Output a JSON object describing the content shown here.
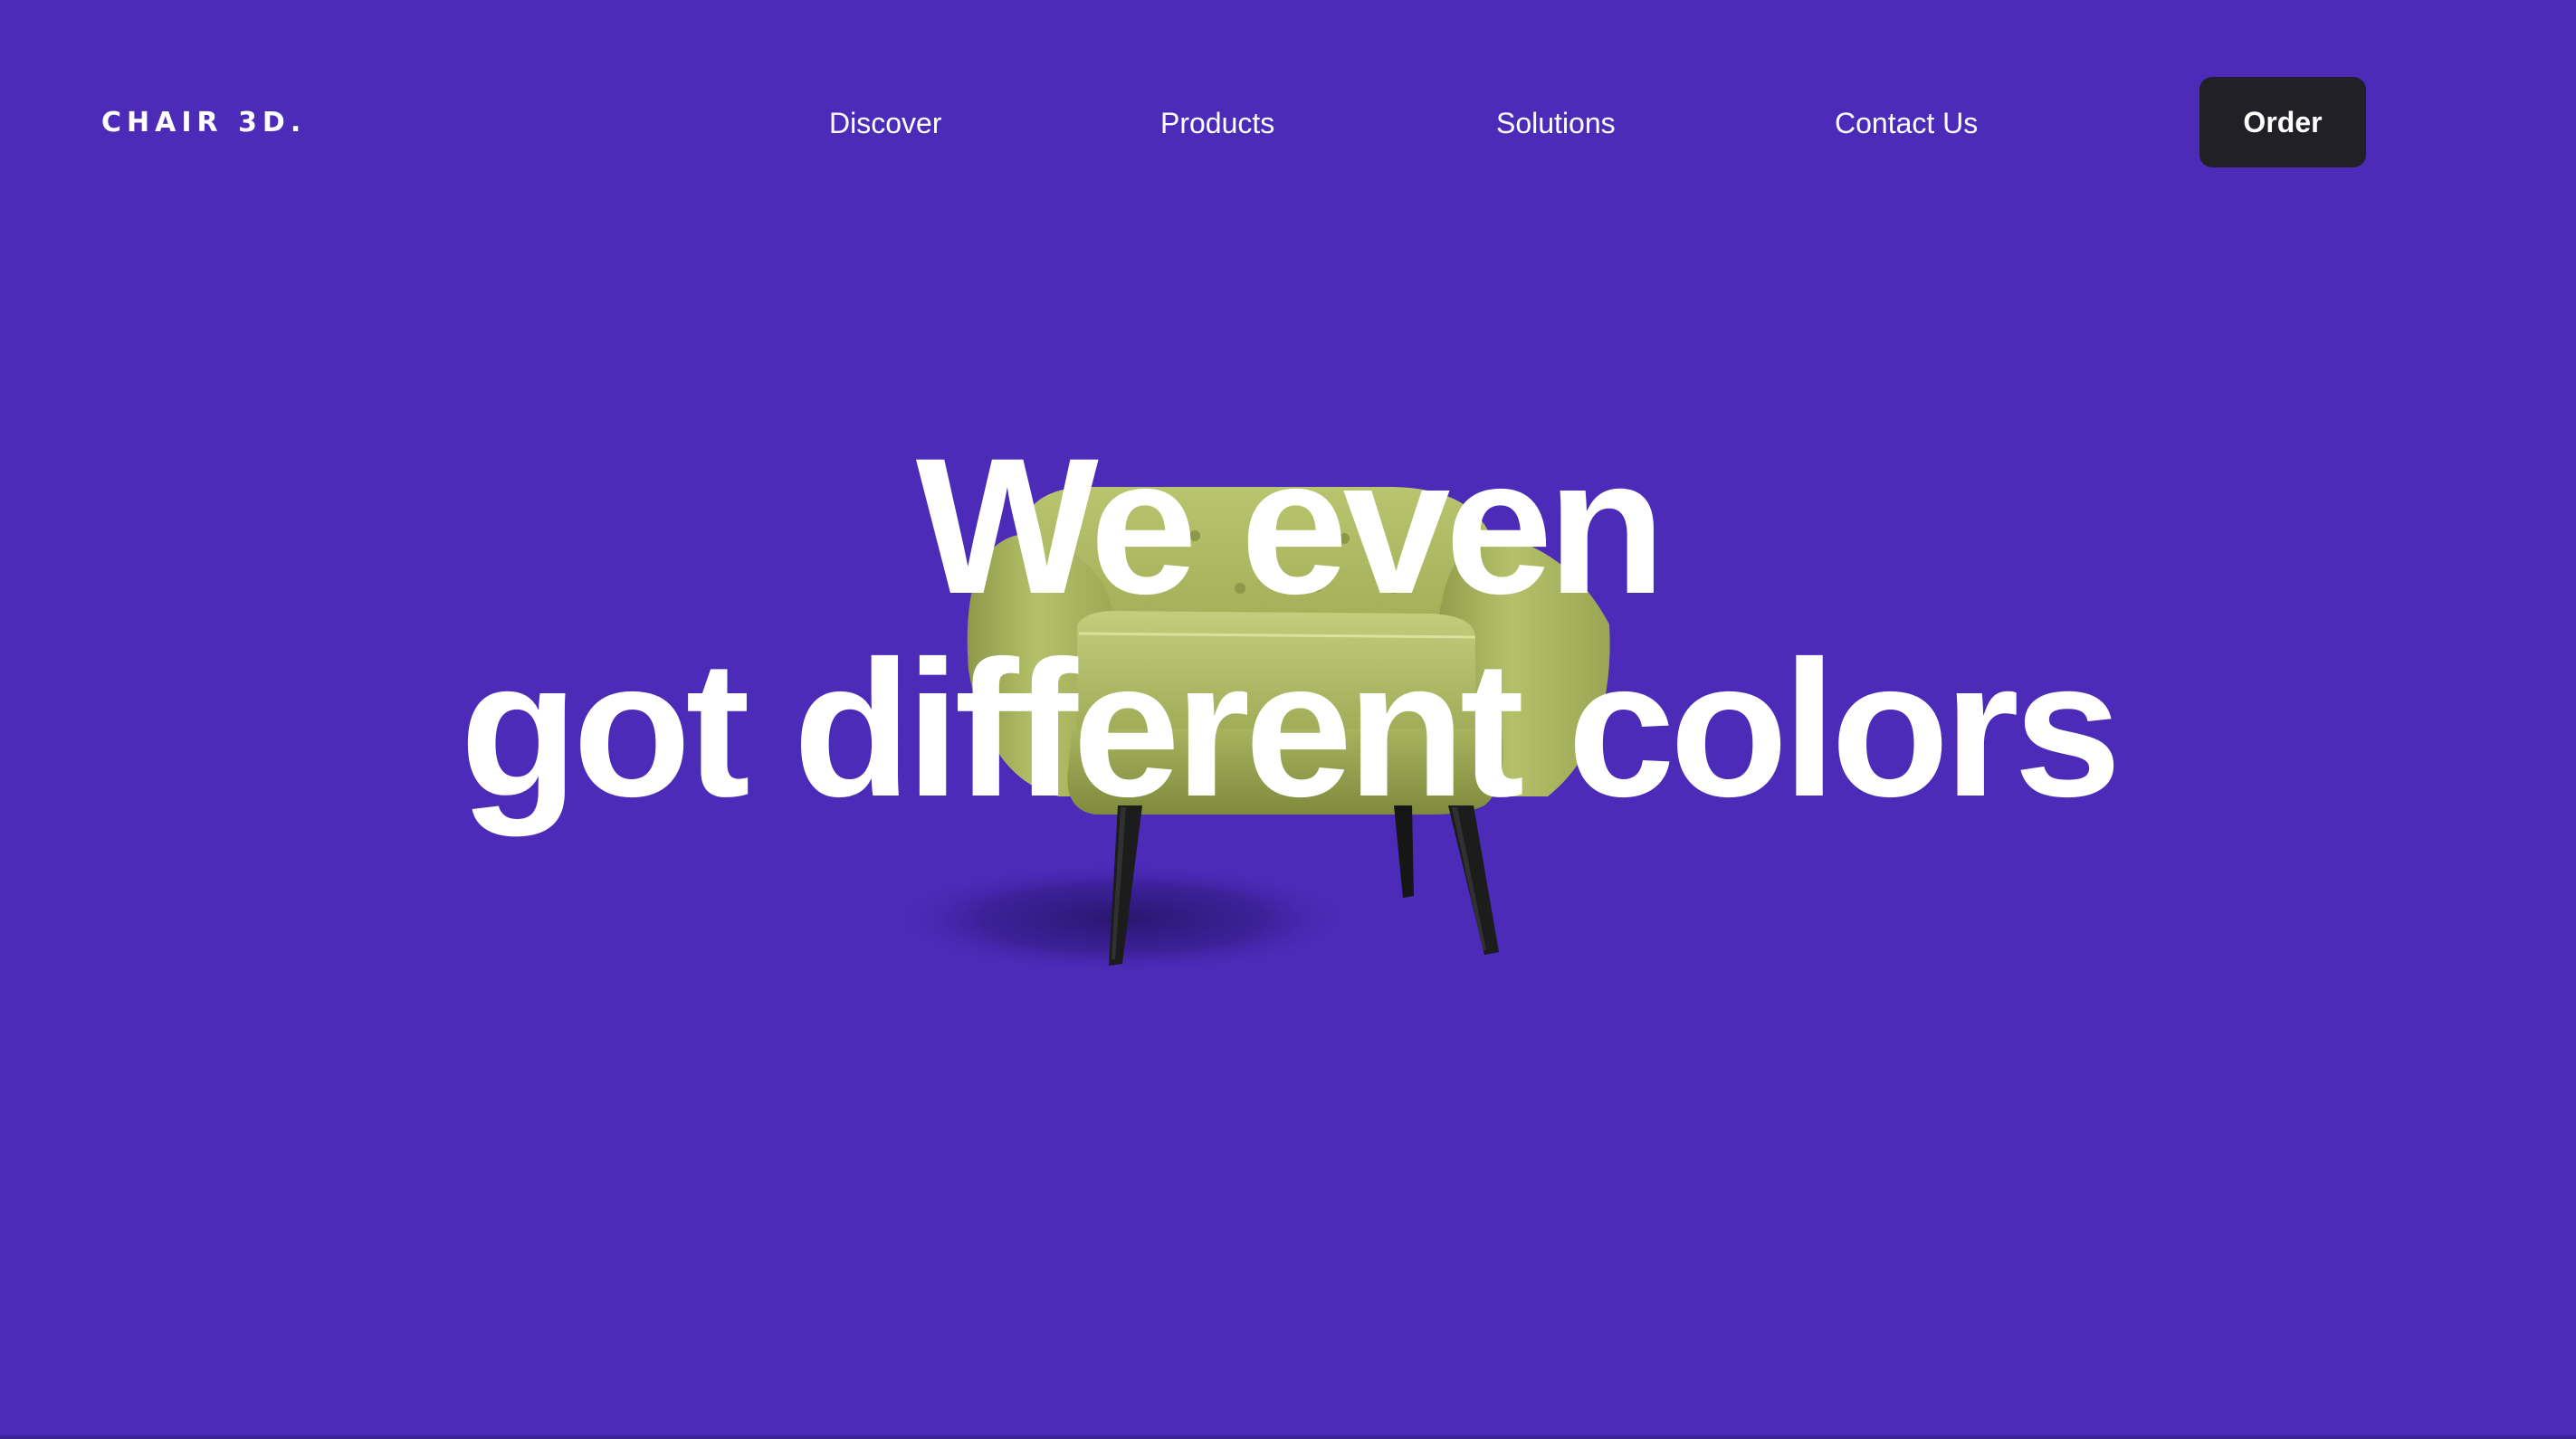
{
  "brand": {
    "logo_text": "CHAIR 3D."
  },
  "nav": {
    "items": [
      {
        "label": "Discover"
      },
      {
        "label": "Products"
      },
      {
        "label": "Solutions"
      },
      {
        "label": "Contact Us"
      }
    ],
    "order_label": "Order"
  },
  "hero": {
    "headline_line1": "We even",
    "headline_line2": "got different colors",
    "image": "green-armchair-image"
  },
  "colors": {
    "background": "#4c2bb9",
    "text": "#ffffff",
    "button_bg": "#212026",
    "chair_fabric": "#a9b55f",
    "chair_legs": "#1c1c1c"
  }
}
